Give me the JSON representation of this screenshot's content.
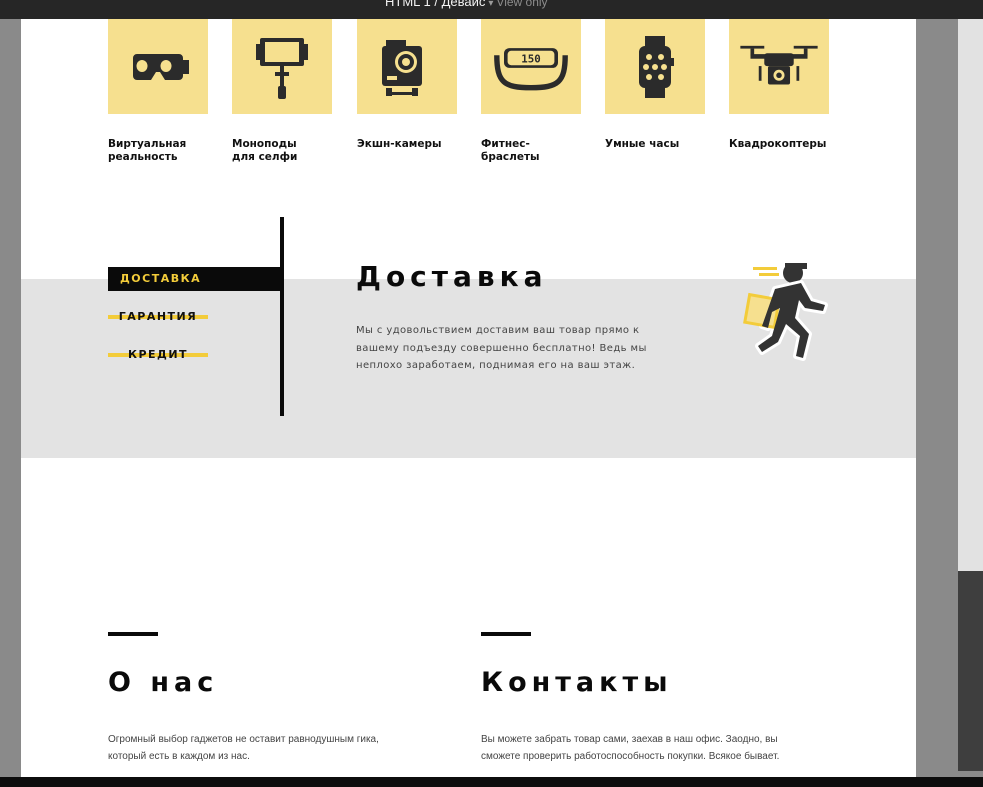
{
  "window": {
    "title": "HTML 1 / Девайс",
    "separator": "▾",
    "mode": "View only"
  },
  "categories": [
    {
      "label": "Виртуальная\nреальность",
      "icon": "vr-headset-icon"
    },
    {
      "label": "Моноподы\nдля селфи",
      "icon": "selfie-stick-icon"
    },
    {
      "label": "Экшн-камеры",
      "icon": "action-camera-icon"
    },
    {
      "label": "Фитнес-браслеты",
      "icon": "fitness-band-icon"
    },
    {
      "label": "Умные часы",
      "icon": "smartwatch-icon"
    },
    {
      "label": "Квадрокоптеры",
      "icon": "drone-icon"
    }
  ],
  "fitness_band_display": "150",
  "service_tabs": [
    {
      "label": "ДОСТАВКА",
      "active": true
    },
    {
      "label": "ГАРАНТИЯ",
      "active": false
    },
    {
      "label": "КРЕДИТ",
      "active": false
    }
  ],
  "delivery": {
    "title": "Доставка",
    "text": "Мы с удовольствием доставим ваш товар прямо к вашему подъезду совершенно бесплатно! Ведь мы неплохо заработаем, поднимая его на ваш этаж.",
    "icon": "courier-icon"
  },
  "about": {
    "title": "О нас",
    "text": "Огромный выбор гаджетов не оставит равнодушным гика, который есть в каждом из нас."
  },
  "contacts": {
    "title": "Контакты",
    "text": "Вы можете забрать товар сами, заехав в наш офис. Заодно, вы сможете проверить работоспособность покупки. Всякое бывает."
  },
  "colors": {
    "accent_yellow": "#f3cc3a",
    "tile_yellow": "#f6e08f",
    "band_gray": "#e3e3e3",
    "text_dark": "#0a0a0a"
  }
}
